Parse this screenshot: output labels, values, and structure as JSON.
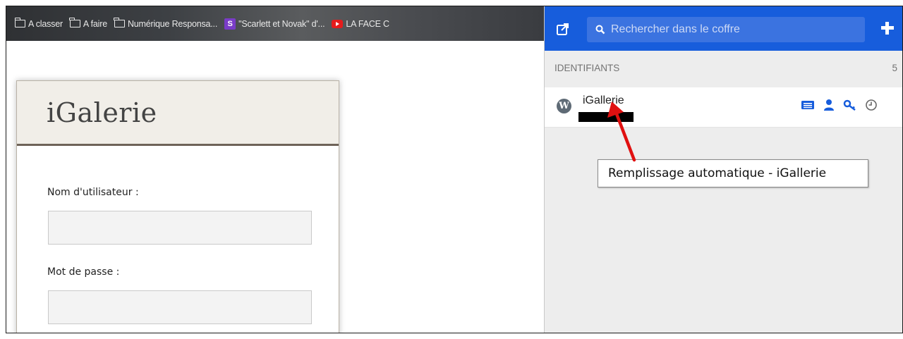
{
  "bookmarks": [
    {
      "label": "A classer",
      "icon": "folder-icon"
    },
    {
      "label": "A faire",
      "icon": "folder-icon"
    },
    {
      "label": "Numérique Responsa...",
      "icon": "folder-icon"
    },
    {
      "label": "\"Scarlett et Novak\" d'...",
      "icon": "site-favicon-icon"
    },
    {
      "label": "LA FACE C",
      "icon": "youtube-icon"
    }
  ],
  "login": {
    "title": "iGalerie",
    "username_label": "Nom d'utilisateur :",
    "username_value": "",
    "password_label": "Mot de passe :",
    "password_value": ""
  },
  "vault": {
    "search_placeholder": "Rechercher dans le coffre",
    "section_label": "IDENTIFIANTS",
    "section_count": "5",
    "item_name": "iGallerie",
    "tooltip": "Remplissage automatique - iGallerie",
    "accent_color": "#175ddc"
  }
}
